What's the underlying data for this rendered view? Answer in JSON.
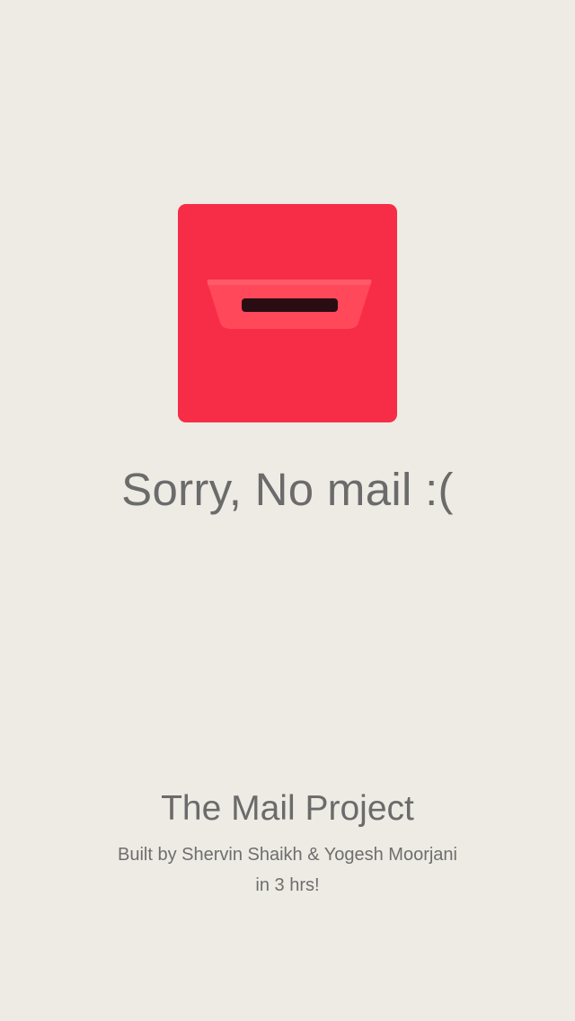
{
  "empty_state": {
    "icon": "mailbox-icon",
    "message": "Sorry, No mail :("
  },
  "footer": {
    "title": "The Mail Project",
    "credit_line1": "Built by Shervin Shaikh & Yogesh Moorjani",
    "credit_line2": "in 3 hrs!"
  },
  "colors": {
    "background": "#eeebe4",
    "mailbox_red": "#f72c46",
    "slot_flap": "#ff4859",
    "slot_opening": "#2a0d13",
    "text": "#6b6b6b"
  }
}
